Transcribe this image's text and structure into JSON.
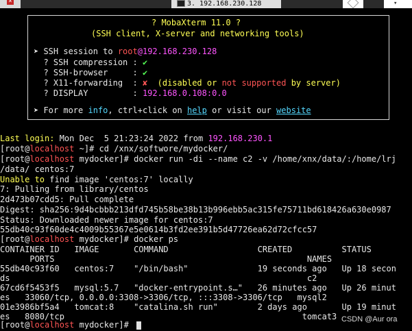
{
  "window": {
    "tab_title": "3. 192.168.230.128"
  },
  "banner": {
    "title": "? MobaXterm 11.0 ?",
    "subtitle": "(SSH client, X-server and networking tools)",
    "session_prefix": "➤ SSH session to ",
    "session_user": "root",
    "session_at": "@",
    "session_host": "192.168.230.128",
    "compression_label": "  ? SSH compression : ",
    "compression_status": "✔",
    "browser_label": "  ? SSH-browser     : ",
    "browser_status": "✔",
    "x11_label": "  ? X11-forwarding  : ",
    "x11_status": "✘",
    "x11_note_a": "  (disabled or ",
    "x11_note_b": "not supported",
    "x11_note_c": " by server)",
    "display_label": "  ? DISPLAY         : ",
    "display_value": "192.168.0.108:0.0",
    "more_a": "➤ For more ",
    "more_info": "info",
    "more_b": ", ctrl+click on ",
    "more_help": "help",
    "more_c": " or visit our ",
    "more_website": "website"
  },
  "terminal": {
    "last_login_label": "Last login:",
    "last_login_text": " Mon Dec  5 21:23:24 2022 from ",
    "last_login_ip": "192.168.230.1",
    "prompt_open": "[root@",
    "prompt_host": "localhost",
    "prompt_home": " ~]# ",
    "prompt_dir": " mydocker]# ",
    "cmd1": "cd /xnx/softwore/mydocker/",
    "cmd2": "docker run -di --name c2 -v /home/xnx/data/:/home/lrj",
    "cmd2_cont": "/data/ centos:7",
    "unable_a": "Unable to",
    "unable_b": " find image 'centos:7' locally",
    "pull1": "7: Pulling from library/centos",
    "pull2": "2d473b07cdd5: Pull complete",
    "digest": "Digest: sha256:9d4bcbbb213dfd745b58be38b13b996ebb5ac315fe75711bd618426a630e0987",
    "status": "Status: Downloaded newer image for centos:7",
    "container_id": "55db40c93f60de4c4009b55367e5e0614b3fd2ee391b5d47726ea62d72cfcc57",
    "cmd3": "docker ps",
    "ps_header1": "CONTAINER ID   IMAGE       COMMAND                  CREATED          STATUS",
    "ps_header2": "      PORTS                                                   NAMES",
    "ps_rows": [
      "55db40c93f60   centos:7    \"/bin/bash\"              19 seconds ago   Up 18 secon",
      "ds                                                            c2",
      "67cd6f5453f5   mysql:5.7   \"docker-entrypoint.s…\"   26 minutes ago   Up 26 minut",
      "es   33060/tcp, 0.0.0.0:3308->3306/tcp, :::3308->3306/tcp   mysql2",
      "01e3986bf5a4   tomcat:8    \"catalina.sh run\"        2 days ago       Up 19 minut",
      "es   8080/tcp                                                tomcat3"
    ]
  },
  "watermark": "CSDN @Aur ora"
}
